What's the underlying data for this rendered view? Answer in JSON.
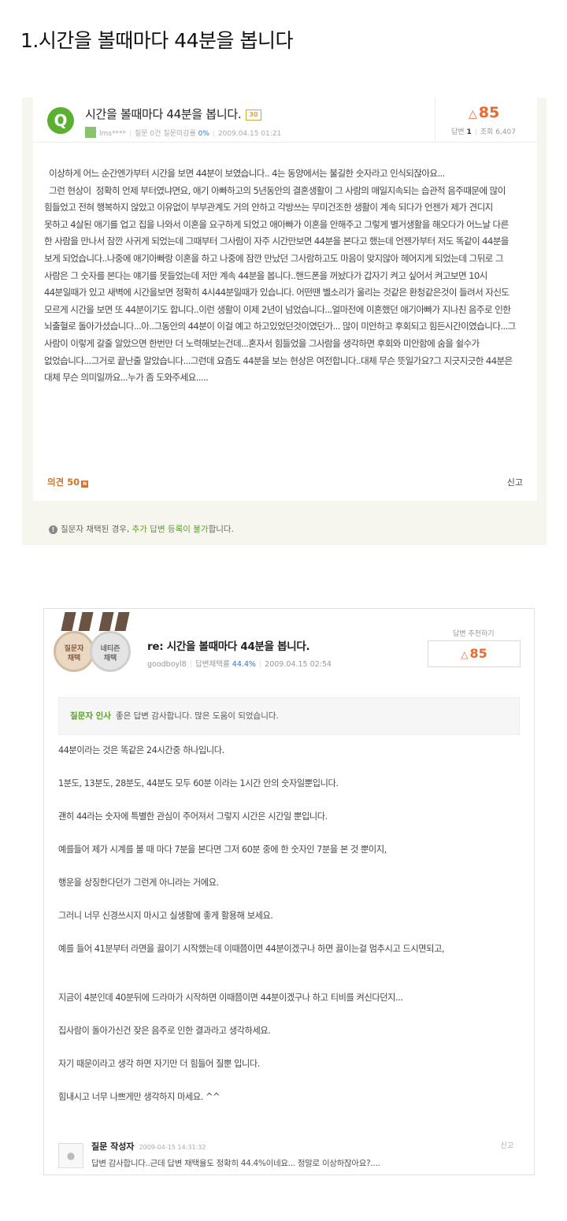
{
  "page_title": "1.시간을 볼때마다 44분을 봅니다",
  "question": {
    "icon_letter": "Q",
    "title": "시간을 볼때마다 44분을 봅니다.",
    "badge": "30",
    "author": "lms****",
    "meta_q_count": "질문 0건",
    "meta_unanswered_label": "질문미감률",
    "meta_unanswered_rate": "0%",
    "date": "2009.04.15 01:21",
    "score": "85",
    "answers_label": "답변",
    "answers_count": "1",
    "views_label": "조회",
    "views_count": "6,407",
    "body": "  이상하게 어느 순간엔가부터 시간을 보면 44분이 보였습니다.. 4는 동양에서는 불길한 숫자라고 인식되잖아요...\n  그런 현상이  정확히 언제 부터였냐면요, 애기 아빠하고의 5년동안의 결혼생활이 그 사람의 매일지속되는 습관적 음주때문에 많이 힘들었고 전혀 행복하지 않았고 이유없이 부부관계도 거의 안하고 각방쓰는 무미건조한 생활이 계속 되다가 언젠가 제가 견디지 못하고 4살된 애기를 업고 집을 나와서 이혼을 요구하게 되었고 애아빠가 이혼을 안해주고 그렇게 별거생활을 해오다가 어느날 다른 한 사람을 만나서 잠깐 사귀게 되었는데 그때부터 그사람이 자주 시간만보면 44분을 본다고 했는데 언젠가부터 저도 똑같이 44분을 보게 되었습니다..나중에 애기아빠랑 이혼을 하고 나중에 잠깐 만났던 그사람하고도 마음이 맞지않아 헤어지게 되었는데 그뒤로 그 사람은 그 숫자를 본다는 얘기를 못들었는데 저만 계속 44분을 봅니다..핸드폰을 꺼놨다가 갑자기 켜고 싶어서 켜고보면 10시 44분일때가 있고 새벽에 시간을보면 정확히 4시44분일때가 있습니다. 어떤땐 벨소리가 울리는 것같은 환청같은것이 들려서 자신도 모르게 시간을 보면 또 44분이기도 합니다..이런 생활이 이제 2년이 넘었습니다...얼마전에 이혼했던 애기아빠가 지나친 음주로 인한 뇌출혈로 돌아가셨습니다...아..그동안의 44분이 이걸 예고 하고있었던것이였던가... 많이 미안하고 후회되고 힘든시간이였습니다...그 사람이 이렇게 갈줄 알았으면 한번만 더 노력해보는건데...혼자서 힘들었을 그사람을 생각하면 후회와 미안함에 숨을 쉴수가 없었습니다...그거로 끝난줄 알았습니다...그런데 요즘도 44분을 보는 현상은 여전합니다..대체 무슨 뜻일가요?그 지긋지긋한 44분은 대체 무슨 의미일까요...누가 좀 도와주세요.....",
    "comments_label": "의견 50",
    "comments_mark": "N",
    "report": "신고",
    "notice_pre": "질문자 채택된 경우, ",
    "notice_hl": "추가 답변 등록이 불가",
    "notice_post": "합니다."
  },
  "answer": {
    "medal_1": [
      "질문자",
      "채택"
    ],
    "medal_2": [
      "네티즌",
      "채택"
    ],
    "title": "re: 시간을 볼때마다 44분을 봅니다.",
    "author": "goodboyl8",
    "rate_label": "답변채택률",
    "rate": "44.4%",
    "date": "2009.04.15 02:54",
    "rec_label": "답변 추천하기",
    "score": "85",
    "greet_label": "질문자 인사",
    "greet_text": "좋은 답변 감사합니다. 많은 도움이 되었습니다.",
    "paragraphs": [
      "44분이라는 것은 똑같은 24시간중 하나입니다.",
      "1분도, 13분도, 28분도, 44분도 모두 60분 이라는 1시간 안의 숫자일뿐입니다.",
      "괜히 44라는 숫자에 특별한 관심이 주어져서 그렇지 시간은 시간일 뿐입니다.",
      "예를들어 제가 시계를 볼 때 마다 7분을 본다면 그저 60분 중에 한 숫자인 7분을 본 것 뿐이지,",
      "행운을 상징한다던가 그런게 아니라는 거에요.",
      "그러니 너무 신경쓰시지 마시고 실생활에 좋게 활용해 보세요.",
      "예를 들어 41분부터 라면을 끓이기 시작했는데 이때쯤이면 44분이겠구나 하면 끓이는걸 멈추시고 드시면되고,",
      "지금이 4분인데 40분뒤에 드라마가 시작하면 이때쯤이면 44분이겠구나 하고 티비를 켜신다던지...",
      "집사람이 돌아가신건 잦은 음주로 인한 결과라고 생각하세요.",
      "자기 때문이라고 생각 하면 자기만 더 힘들어 질뿐 입니다.",
      "힘내시고 너무 나쁘게만 생각하지 마세요. ^^"
    ],
    "comment_author": "질문 작성자",
    "comment_date": "2009-04-15 14:31:32",
    "comment_text": "답변 감사합니다..근데 답변 채택율도 정확히 44.4%이네요... 정말로 이상하잖아요?....",
    "comment_report": "신고"
  }
}
